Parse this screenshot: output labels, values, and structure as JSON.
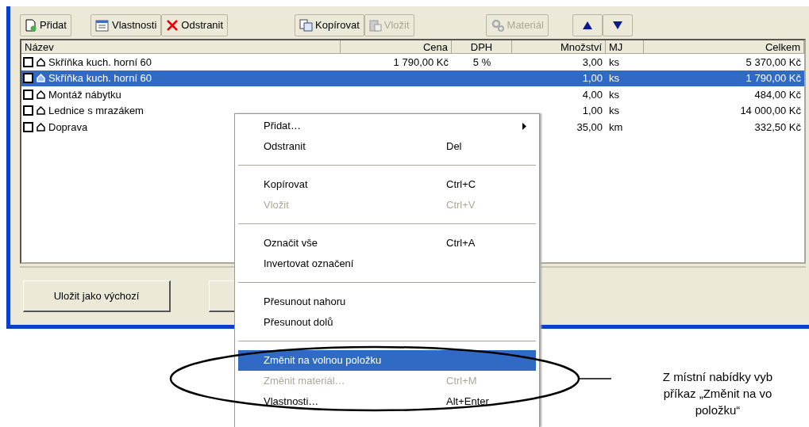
{
  "toolbar": [
    {
      "kind": "add",
      "label": "Přidat",
      "disabled": false
    },
    {
      "kind": "properties",
      "label": "Vlastnosti",
      "disabled": false
    },
    {
      "kind": "delete",
      "label": "Odstranit",
      "disabled": false
    },
    {
      "kind": "copy",
      "label": "Kopírovat",
      "disabled": false
    },
    {
      "kind": "paste",
      "label": "Vložit",
      "disabled": true
    },
    {
      "kind": "material",
      "label": "Materiál",
      "disabled": true
    },
    {
      "kind": "up"
    },
    {
      "kind": "down"
    }
  ],
  "table": {
    "columns": [
      {
        "label": "Název"
      },
      {
        "label": "Cena"
      },
      {
        "label": "DPH"
      },
      {
        "label": "Množství"
      },
      {
        "label": "MJ"
      },
      {
        "label": "Celkem"
      }
    ],
    "rows": [
      {
        "checked": false,
        "selected": false,
        "cells": [
          "Skříňka kuch. horní 60",
          "1 790,00 Kč",
          "5 %",
          "3,00",
          "ks",
          "5 370,00 Kč"
        ]
      },
      {
        "checked": false,
        "selected": true,
        "cells": [
          "Skříňka kuch. horní 60",
          "",
          "",
          "1,00",
          "ks",
          "1 790,00 Kč"
        ]
      },
      {
        "checked": false,
        "selected": false,
        "cells": [
          "Montáž nábytku",
          "",
          "",
          "4,00",
          "ks",
          "484,00 Kč"
        ]
      },
      {
        "checked": false,
        "selected": false,
        "cells": [
          "Lednice s mrazákem",
          "",
          "",
          "1,00",
          "ks",
          "14 000,00 Kč"
        ]
      },
      {
        "checked": false,
        "selected": false,
        "cells": [
          "Doprava",
          "",
          "",
          "35,00",
          "km",
          "332,50 Kč"
        ]
      }
    ]
  },
  "buttons": [
    {
      "label": "Uložit jako výchozí"
    }
  ],
  "context_menu": {
    "items": [
      {
        "kind": "item",
        "label": "Přidat…",
        "submenu": true,
        "disabled": false,
        "selected": false
      },
      {
        "kind": "item",
        "label": "Odstranit",
        "shortcut": "Del",
        "disabled": false,
        "selected": false
      },
      {
        "kind": "separator"
      },
      {
        "kind": "item",
        "label": "Kopírovat",
        "shortcut": "Ctrl+C",
        "disabled": false,
        "selected": false
      },
      {
        "kind": "item",
        "label": "Vložit",
        "shortcut": "Ctrl+V",
        "disabled": true,
        "selected": false
      },
      {
        "kind": "separator"
      },
      {
        "kind": "item",
        "label": "Označit vše",
        "shortcut": "Ctrl+A",
        "disabled": false,
        "selected": false
      },
      {
        "kind": "item",
        "label": "Invertovat označení",
        "disabled": false,
        "selected": false
      },
      {
        "kind": "separator"
      },
      {
        "kind": "item",
        "label": "Přesunout nahoru",
        "disabled": false,
        "selected": false
      },
      {
        "kind": "item",
        "label": "Přesunout dolů",
        "disabled": false,
        "selected": false
      },
      {
        "kind": "separator"
      },
      {
        "kind": "item",
        "label": "Změnit na volnou položku",
        "disabled": false,
        "selected": true
      },
      {
        "kind": "item",
        "label": "Změnit materiál…",
        "shortcut": "Ctrl+M",
        "disabled": true,
        "selected": false
      },
      {
        "kind": "item",
        "label": "Vlastnosti…",
        "shortcut": "Alt+Enter",
        "disabled": false,
        "selected": false
      }
    ]
  },
  "callout": {
    "lines": [
      "Z místní nabídky vyb",
      "příkaz „Změnit na vo",
      "položku“"
    ]
  }
}
